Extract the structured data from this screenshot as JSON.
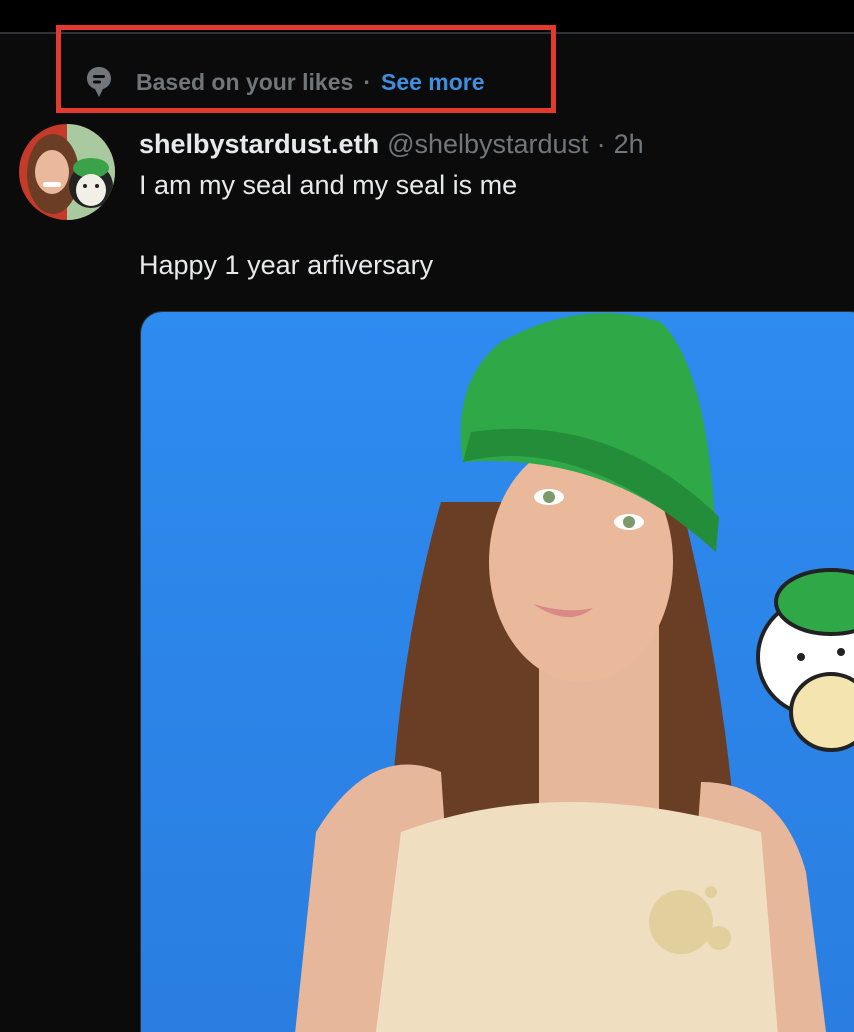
{
  "context": {
    "icon": "topic-icon",
    "text": "Based on your likes",
    "separator": "·",
    "link_label": "See more"
  },
  "tweet": {
    "display_name": "shelbystardust.eth",
    "handle": "@shelbystardust",
    "separator": "·",
    "time": "2h",
    "lines": [
      "I am my seal and my seal is me",
      "Happy 1 year arfiversary"
    ]
  },
  "colors": {
    "background": "#0b0b0b",
    "highlight": "#e23a2e",
    "link": "#3e8fe0",
    "muted": "#71767b",
    "text": "#e7e9ea",
    "media_sky": "#2f86ec"
  }
}
